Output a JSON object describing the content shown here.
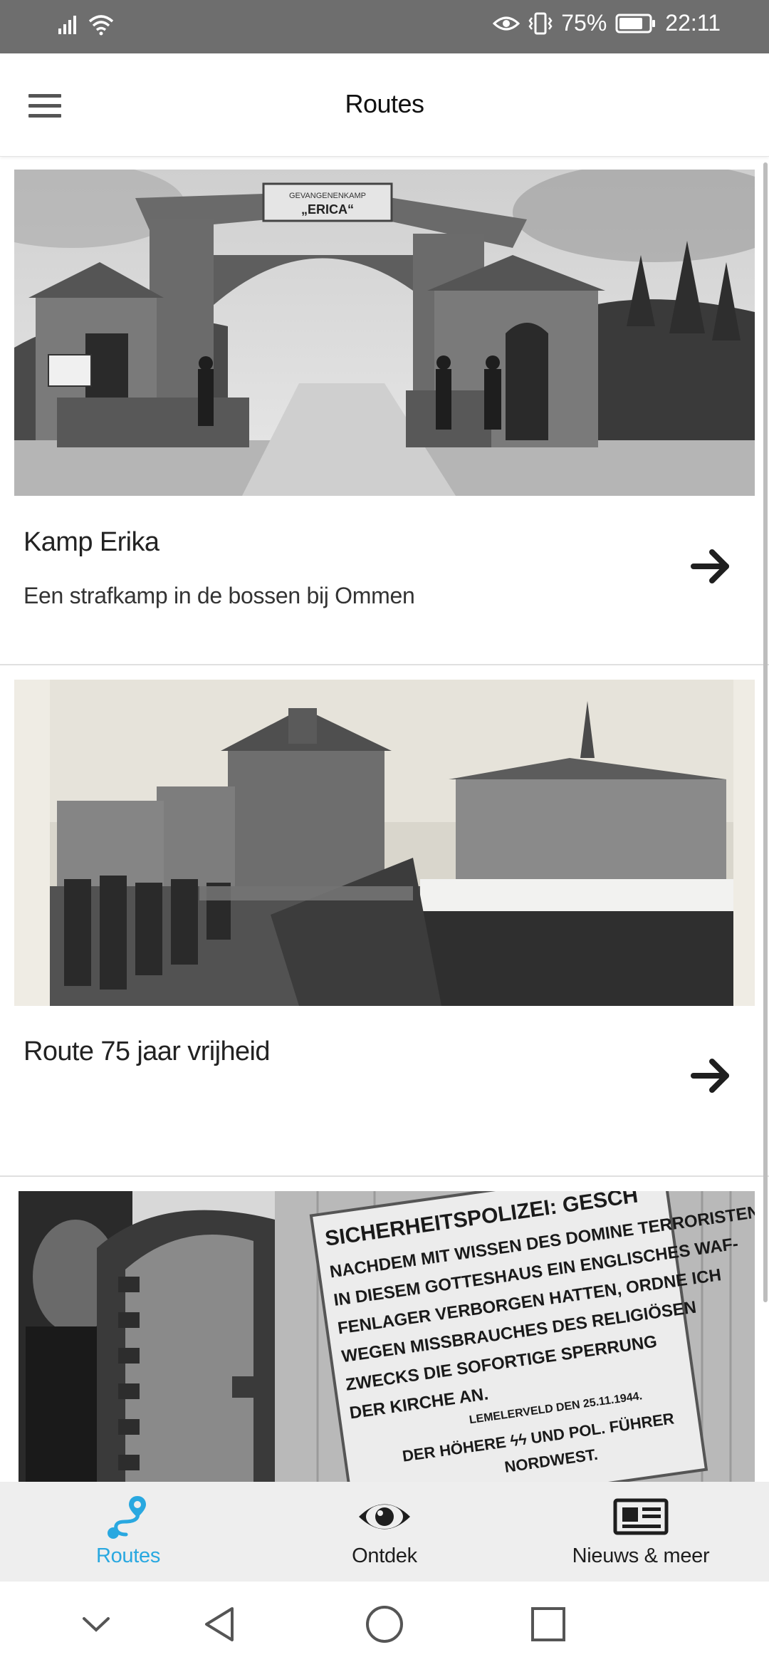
{
  "status_bar": {
    "battery_percent": "75%",
    "time": "22:11",
    "icons": [
      "signal-icon",
      "wifi-icon",
      "eye-comfort-icon",
      "vibrate-icon",
      "battery-icon"
    ]
  },
  "app_bar": {
    "title": "Routes",
    "menu_icon": "hamburger-menu-icon"
  },
  "routes": [
    {
      "title": "Kamp Erika",
      "subtitle": "Een strafkamp in de bossen bij Ommen",
      "image_sign": "GEVANGENENKAMP „ERICA“",
      "arrow_icon": "arrow-right-icon"
    },
    {
      "title": "Route 75 jaar vrijheid",
      "subtitle": "",
      "arrow_icon": "arrow-right-icon"
    },
    {
      "title": "",
      "subtitle": "",
      "image_sign_lines": [
        "SICHERHEITSPOLIZEI: GESCH",
        "NACHDEM MIT WISSEN DES DOMINE TERRORISTEN",
        "IN DIESEM GOTTESHAUS EIN ENGLISCHES WAF-",
        "FENLAGER VERBORGEN HATTEN, ORDNE ICH",
        "WEGEN MISSBRAUCHES DES RELIGIÖSEN",
        "ZWECKS DIE SOFORTIGE SPERRUNG",
        "DER KIRCHE AN.",
        "LEMELERVELD DEN 25.11.1944.",
        "DER HÖHERE ϟϟ UND POL. FÜHRER",
        "NORDWEST."
      ]
    }
  ],
  "bottom_nav": {
    "items": [
      {
        "label": "Routes",
        "icon": "route-icon",
        "active": true
      },
      {
        "label": "Ontdek",
        "icon": "eye-icon",
        "active": false
      },
      {
        "label": "Nieuws & meer",
        "icon": "newspaper-icon",
        "active": false
      }
    ]
  },
  "colors": {
    "accent": "#29a8e0",
    "status_bar": "#6e6e6e",
    "nav_background": "#eeeeee",
    "text": "#222222"
  }
}
